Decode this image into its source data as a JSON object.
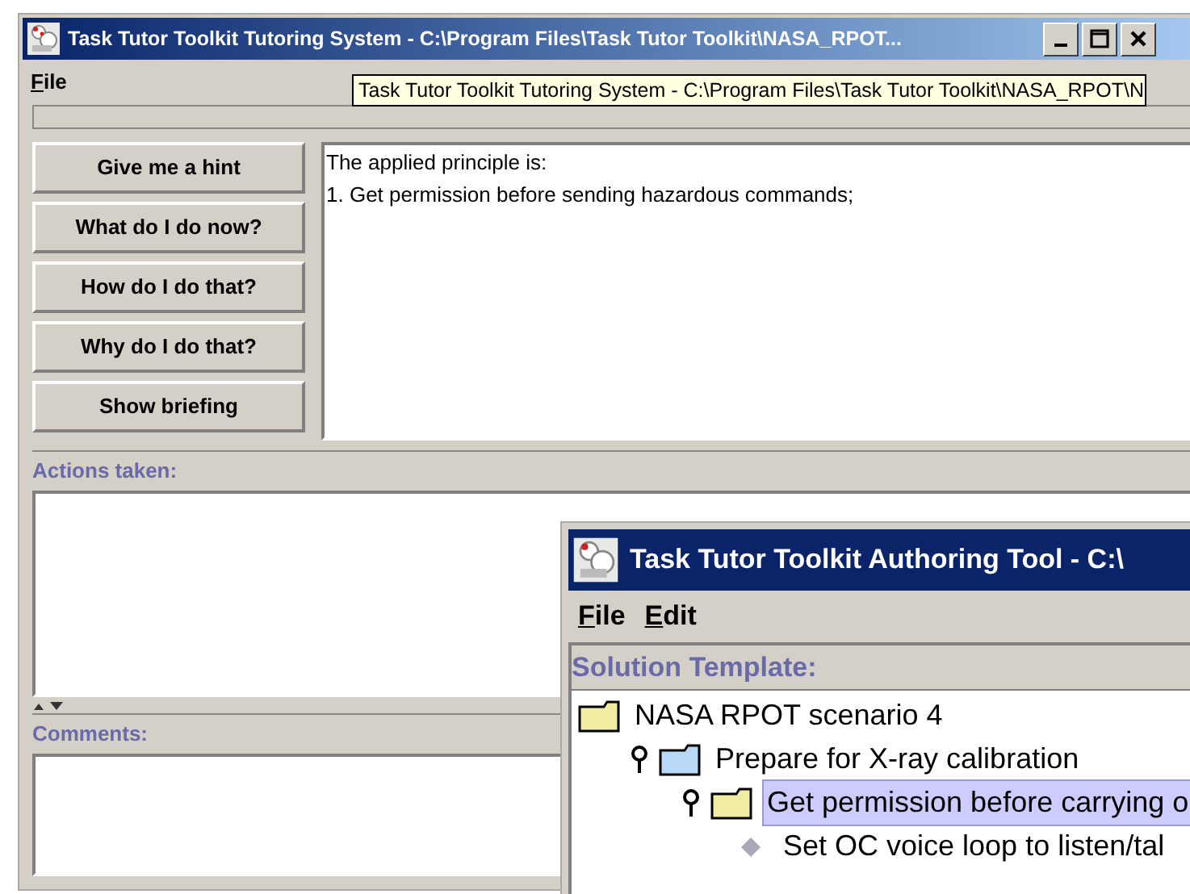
{
  "main_window": {
    "title": "Task Tutor Toolkit Tutoring System - C:\\Program Files\\Task Tutor Toolkit\\NASA_RPOT...",
    "menu": [
      "File"
    ],
    "tooltip": "Task Tutor Toolkit Tutoring System - C:\\Program Files\\Task Tutor Toolkit\\NASA_RPOT\\N",
    "buttons": [
      "Give me a hint",
      "What do I do now?",
      "How do I do that?",
      "Why do I do that?",
      "Show briefing"
    ],
    "hint_text": [
      "The applied principle is:",
      "1. Get permission before sending hazardous commands;"
    ],
    "actions_label": "Actions taken:",
    "comments_label": "Comments:"
  },
  "authoring_window": {
    "title": "Task Tutor Toolkit Authoring Tool - C:\\",
    "menu": [
      "File",
      "Edit"
    ],
    "section_label": "Solution Template:",
    "tree": [
      {
        "kind": "folder",
        "label": "NASA RPOT scenario 4",
        "color": "#f0eca0",
        "selected": false,
        "children": [
          {
            "kind": "folder",
            "label": "Prepare for X-ray calibration",
            "color": "#b8d8f8",
            "expanded": true,
            "selected": false,
            "children": [
              {
                "kind": "folder",
                "label": "Get permission before carrying o",
                "color": "#f0eca0",
                "expanded": true,
                "selected": true,
                "children": [
                  {
                    "kind": "leaf",
                    "label": "Set OC voice loop to listen/tal",
                    "selected": false
                  }
                ]
              }
            ]
          }
        ]
      }
    ]
  }
}
